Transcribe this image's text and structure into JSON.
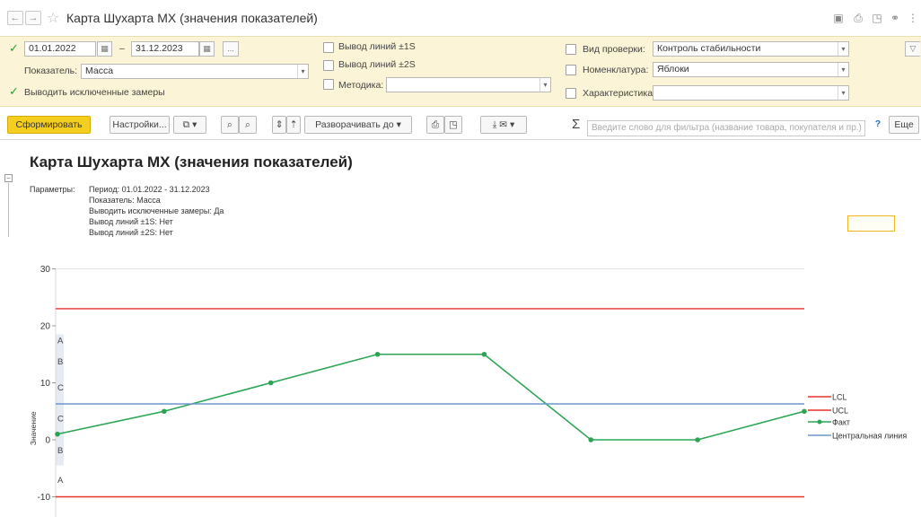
{
  "window": {
    "title": "Карта Шухарта MX (значения показателей)",
    "back_icon": "arrow-left-icon",
    "forward_icon": "arrow-right-icon",
    "favorite_icon": "star-icon"
  },
  "filters": {
    "period_enabled": true,
    "date_from": "01.01.2022",
    "date_separator": "–",
    "date_to": "31.12.2023",
    "period_button": "...",
    "indicator_label": "Показатель:",
    "indicator_value": "Масса",
    "exclude_checked": true,
    "exclude_label": "Выводить исключенные замеры",
    "lines1s_label": "Вывод линий ±1S",
    "lines2s_label": "Вывод линий ±2S",
    "method_label": "Методика:",
    "method_value": "",
    "check_type_label": "Вид проверки:",
    "check_type_value": "Контроль стабильности",
    "nomenclature_label": "Номенклатура:",
    "nomenclature_value": "Яблоки",
    "characteristic_label": "Характеристика:",
    "characteristic_value": ""
  },
  "toolbar": {
    "generate": "Сформировать",
    "settings": "Настройки...",
    "expand": "Разворачивать до",
    "search_placeholder": "Введите слово для фильтра (название товара, покупателя и пр.)",
    "help": "?",
    "more": "Еще"
  },
  "report": {
    "title": "Карта Шухарта MX (значения показателей)",
    "params_label": "Параметры:",
    "params": [
      "Период: 01.01.2022 - 31.12.2023",
      "Показатель: Масса",
      "Выводить исключенные замеры: Да",
      "Вывод линий ±1S: Нет",
      "Вывод линий ±2S: Нет"
    ]
  },
  "chart_data": {
    "type": "line",
    "ylabel": "Значение",
    "xlabel": "",
    "ylim": [
      -10,
      30
    ],
    "yticks": [
      -10,
      0,
      10,
      20,
      30
    ],
    "zone_labels": [
      "A",
      "B",
      "C",
      "C",
      "B",
      "A"
    ],
    "series": [
      {
        "name": "LCL",
        "color": "#e8322c",
        "values": [
          -10,
          -10
        ]
      },
      {
        "name": "UCL",
        "color": "#e8322c",
        "values": [
          23,
          23
        ]
      },
      {
        "name": "Факт",
        "color": "#2ba553",
        "marker": true,
        "values": [
          1,
          5,
          10,
          15,
          15,
          0,
          0,
          5
        ]
      },
      {
        "name": "Центральная линия",
        "color": "#6f97c9",
        "values": [
          6.3,
          6.3
        ]
      }
    ]
  }
}
